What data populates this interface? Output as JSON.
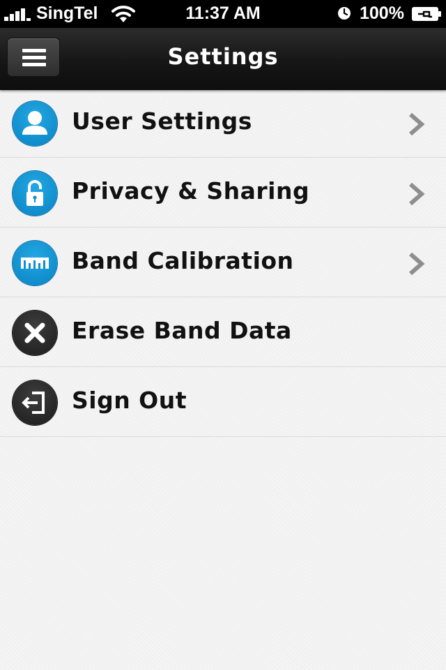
{
  "status_bar": {
    "carrier": "SingTel",
    "time": "11:37 AM",
    "battery_percent": "100%",
    "signal_icon": "signal-bars-icon",
    "wifi_icon": "wifi-icon",
    "alarm_icon": "clock-icon",
    "battery_icon": "battery-charging-icon"
  },
  "nav": {
    "title": "Settings",
    "menu_icon": "hamburger-menu-icon"
  },
  "menu": [
    {
      "label": "User Settings",
      "icon": "user-icon",
      "icon_color": "#0a8fd0",
      "has_chevron": true
    },
    {
      "label": "Privacy & Sharing",
      "icon": "lock-icon",
      "icon_color": "#0a8fd0",
      "has_chevron": true
    },
    {
      "label": "Band Calibration",
      "icon": "ruler-icon",
      "icon_color": "#0a8fd0",
      "has_chevron": true
    },
    {
      "label": "Erase Band Data",
      "icon": "erase-x-icon",
      "icon_color": "#2a2a2a",
      "has_chevron": false
    },
    {
      "label": "Sign Out",
      "icon": "sign-out-icon",
      "icon_color": "#2a2a2a",
      "has_chevron": false
    }
  ],
  "colors": {
    "accent_blue": "#0a8fd0",
    "dark_icon": "#2a2a2a",
    "nav_background": "#1a1a1a",
    "list_background": "#f2f2f2"
  }
}
